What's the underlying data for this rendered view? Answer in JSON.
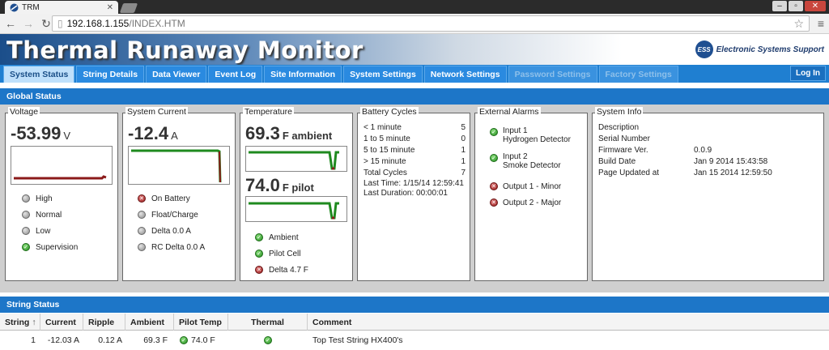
{
  "browser": {
    "tab_title": "TRM",
    "url_host": "192.168.1.155",
    "url_path": "/INDEX.HTM"
  },
  "header": {
    "title": "Thermal Runaway Monitor",
    "logo_mark": "ESS",
    "logo_text": "Electronic Systems Support"
  },
  "nav": {
    "tabs": [
      {
        "label": "System Status"
      },
      {
        "label": "String Details"
      },
      {
        "label": "Data Viewer"
      },
      {
        "label": "Event Log"
      },
      {
        "label": "Site Information"
      },
      {
        "label": "System Settings"
      },
      {
        "label": "Network Settings"
      },
      {
        "label": "Password Settings"
      },
      {
        "label": "Factory Settings"
      }
    ],
    "login": "Log In"
  },
  "global_status": {
    "title": "Global Status",
    "voltage": {
      "title": "Voltage",
      "value": "-53.99",
      "unit": "V",
      "statuses": [
        "High",
        "Normal",
        "Low",
        "Supervision"
      ]
    },
    "current": {
      "title": "System Current",
      "value": "-12.4",
      "unit": "A",
      "statuses": [
        "On Battery",
        "Float/Charge",
        "Delta 0.0 A",
        "RC Delta 0.0 A"
      ]
    },
    "temperature": {
      "title": "Temperature",
      "ambient_value": "69.3",
      "ambient_unit": "F ambient",
      "pilot_value": "74.0",
      "pilot_unit": "F pilot",
      "statuses": [
        "Ambient",
        "Pilot Cell",
        "Delta 4.7 F"
      ]
    },
    "battery_cycles": {
      "title": "Battery Cycles",
      "rows": [
        {
          "label": "< 1 minute",
          "value": "5"
        },
        {
          "label": "1 to 5 minute",
          "value": "0"
        },
        {
          "label": "5 to 15 minute",
          "value": "1"
        },
        {
          "label": "> 15 minute",
          "value": "1"
        },
        {
          "label": "Total Cycles",
          "value": "7"
        }
      ],
      "last_time": "Last Time: 1/15/14 12:59:41",
      "last_duration": "Last Duration: 00:00:01"
    },
    "external_alarms": {
      "title": "External Alarms",
      "items": [
        {
          "line1": "Input 1",
          "line2": "Hydrogen Detector",
          "state": "ok"
        },
        {
          "line1": "Input 2",
          "line2": "Smoke Detector",
          "state": "ok"
        },
        {
          "line1": "Output 1 - Minor",
          "line2": "",
          "state": "alarm"
        },
        {
          "line1": "Output 2 - Major",
          "line2": "",
          "state": "alarm"
        }
      ]
    },
    "system_info": {
      "title": "System Info",
      "rows": [
        {
          "label": "Description",
          "value": ""
        },
        {
          "label": "Serial Number",
          "value": ""
        },
        {
          "label": "Firmware Ver.",
          "value": "0.0.9"
        },
        {
          "label": "Build Date",
          "value": "Jan 9 2014 15:43:58"
        },
        {
          "label": "Page Updated at",
          "value": "Jan 15 2014 12:59:50"
        }
      ]
    }
  },
  "string_status": {
    "title": "String Status",
    "columns": [
      "String",
      "Current",
      "Ripple",
      "Ambient",
      "Pilot Temp",
      "Thermal",
      "Comment"
    ],
    "sort_indicator": "↑",
    "rows": [
      {
        "string": "1",
        "current": "-12.03 A",
        "ripple": "0.12 A",
        "ambient": "69.3 F",
        "pilot_temp": "74.0 F",
        "comment": "Top Test String HX400's"
      }
    ]
  }
}
